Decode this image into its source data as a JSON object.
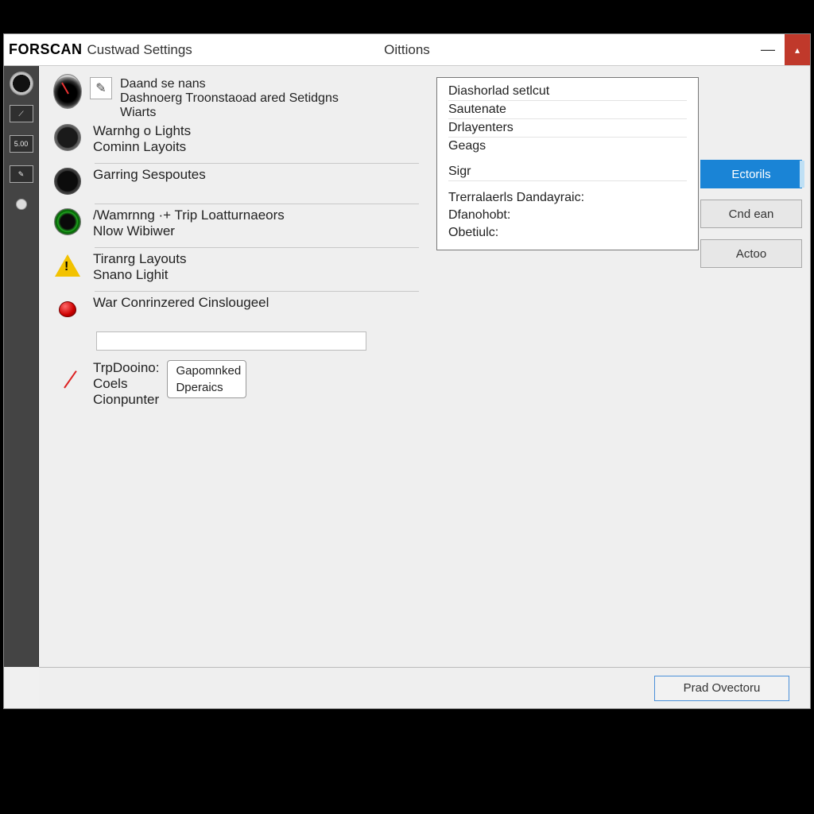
{
  "titlebar": {
    "app": "FORSCAN",
    "sub": "Custwad Settings",
    "center": "Oittions"
  },
  "sidebar": {
    "badge": "5.00"
  },
  "list": {
    "first": {
      "l1": "Daand se nans",
      "l2": "Dashnoerg Troonstaoad ared Setidgns",
      "l3": "Wiarts"
    },
    "i1": {
      "a": "Warnhg o Lights",
      "b": "Cominn Layoits"
    },
    "i2": {
      "a": "Garring Sespoutes"
    },
    "i3": {
      "a": "/Wamrnng ·+ Trip Loatturnaeors",
      "b": "Nlow Wibiwer"
    },
    "i4": {
      "a": "Tiranrg Layouts",
      "b": "Snano Lighit"
    },
    "i5": {
      "a": "War Conrinzered Cinslougeel"
    },
    "i6": {
      "a": "TrpDooino:",
      "b": "Coels",
      "c": "Cionpunter"
    },
    "sel": {
      "a": "Gapomnked",
      "b": "Dperaics"
    }
  },
  "panel": {
    "p1": "Diashorlad setlcut",
    "p2": "Sautenate",
    "p3": "Drlayenters",
    "p4": "Geags",
    "p5": "Sigr",
    "p6": "Trerralaerls Dandayraic:",
    "p7": "Dfanohobt:",
    "p8": "Obetiulc:"
  },
  "buttons": {
    "b1": "Ectorils",
    "b2": "Cnd ean",
    "b3": "Actoo"
  },
  "footer": {
    "ok": "Prad Ovectoru"
  }
}
